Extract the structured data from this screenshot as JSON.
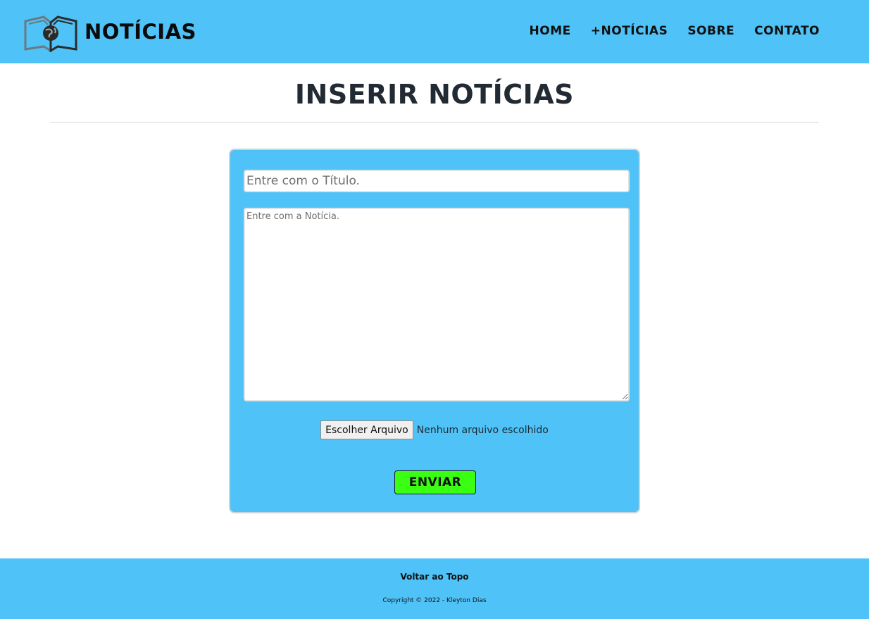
{
  "header": {
    "logo_icon": "newspaper-globe-icon",
    "brand": "NOTÍCIAS",
    "nav": [
      {
        "label": "HOME"
      },
      {
        "label": "+NOTÍCIAS"
      },
      {
        "label": "SOBRE"
      },
      {
        "label": "CONTATO"
      }
    ]
  },
  "main": {
    "title": "INSERIR NOTÍCIAS",
    "form": {
      "title_placeholder": "Entre com o Título.",
      "title_value": "",
      "body_placeholder": "Entre com a Notícia.",
      "body_value": "",
      "file_button_label": "Escolher Arquivo",
      "file_status": "Nenhum arquivo escolhido",
      "submit_label": "ENVIAR"
    }
  },
  "footer": {
    "back_to_top": "Voltar ao Topo",
    "copyright": "Copyright © 2022 - Kleyton Dias"
  },
  "colors": {
    "accent": "#4fc2f7",
    "submit": "#3bff12",
    "text_dark": "#222a33"
  }
}
